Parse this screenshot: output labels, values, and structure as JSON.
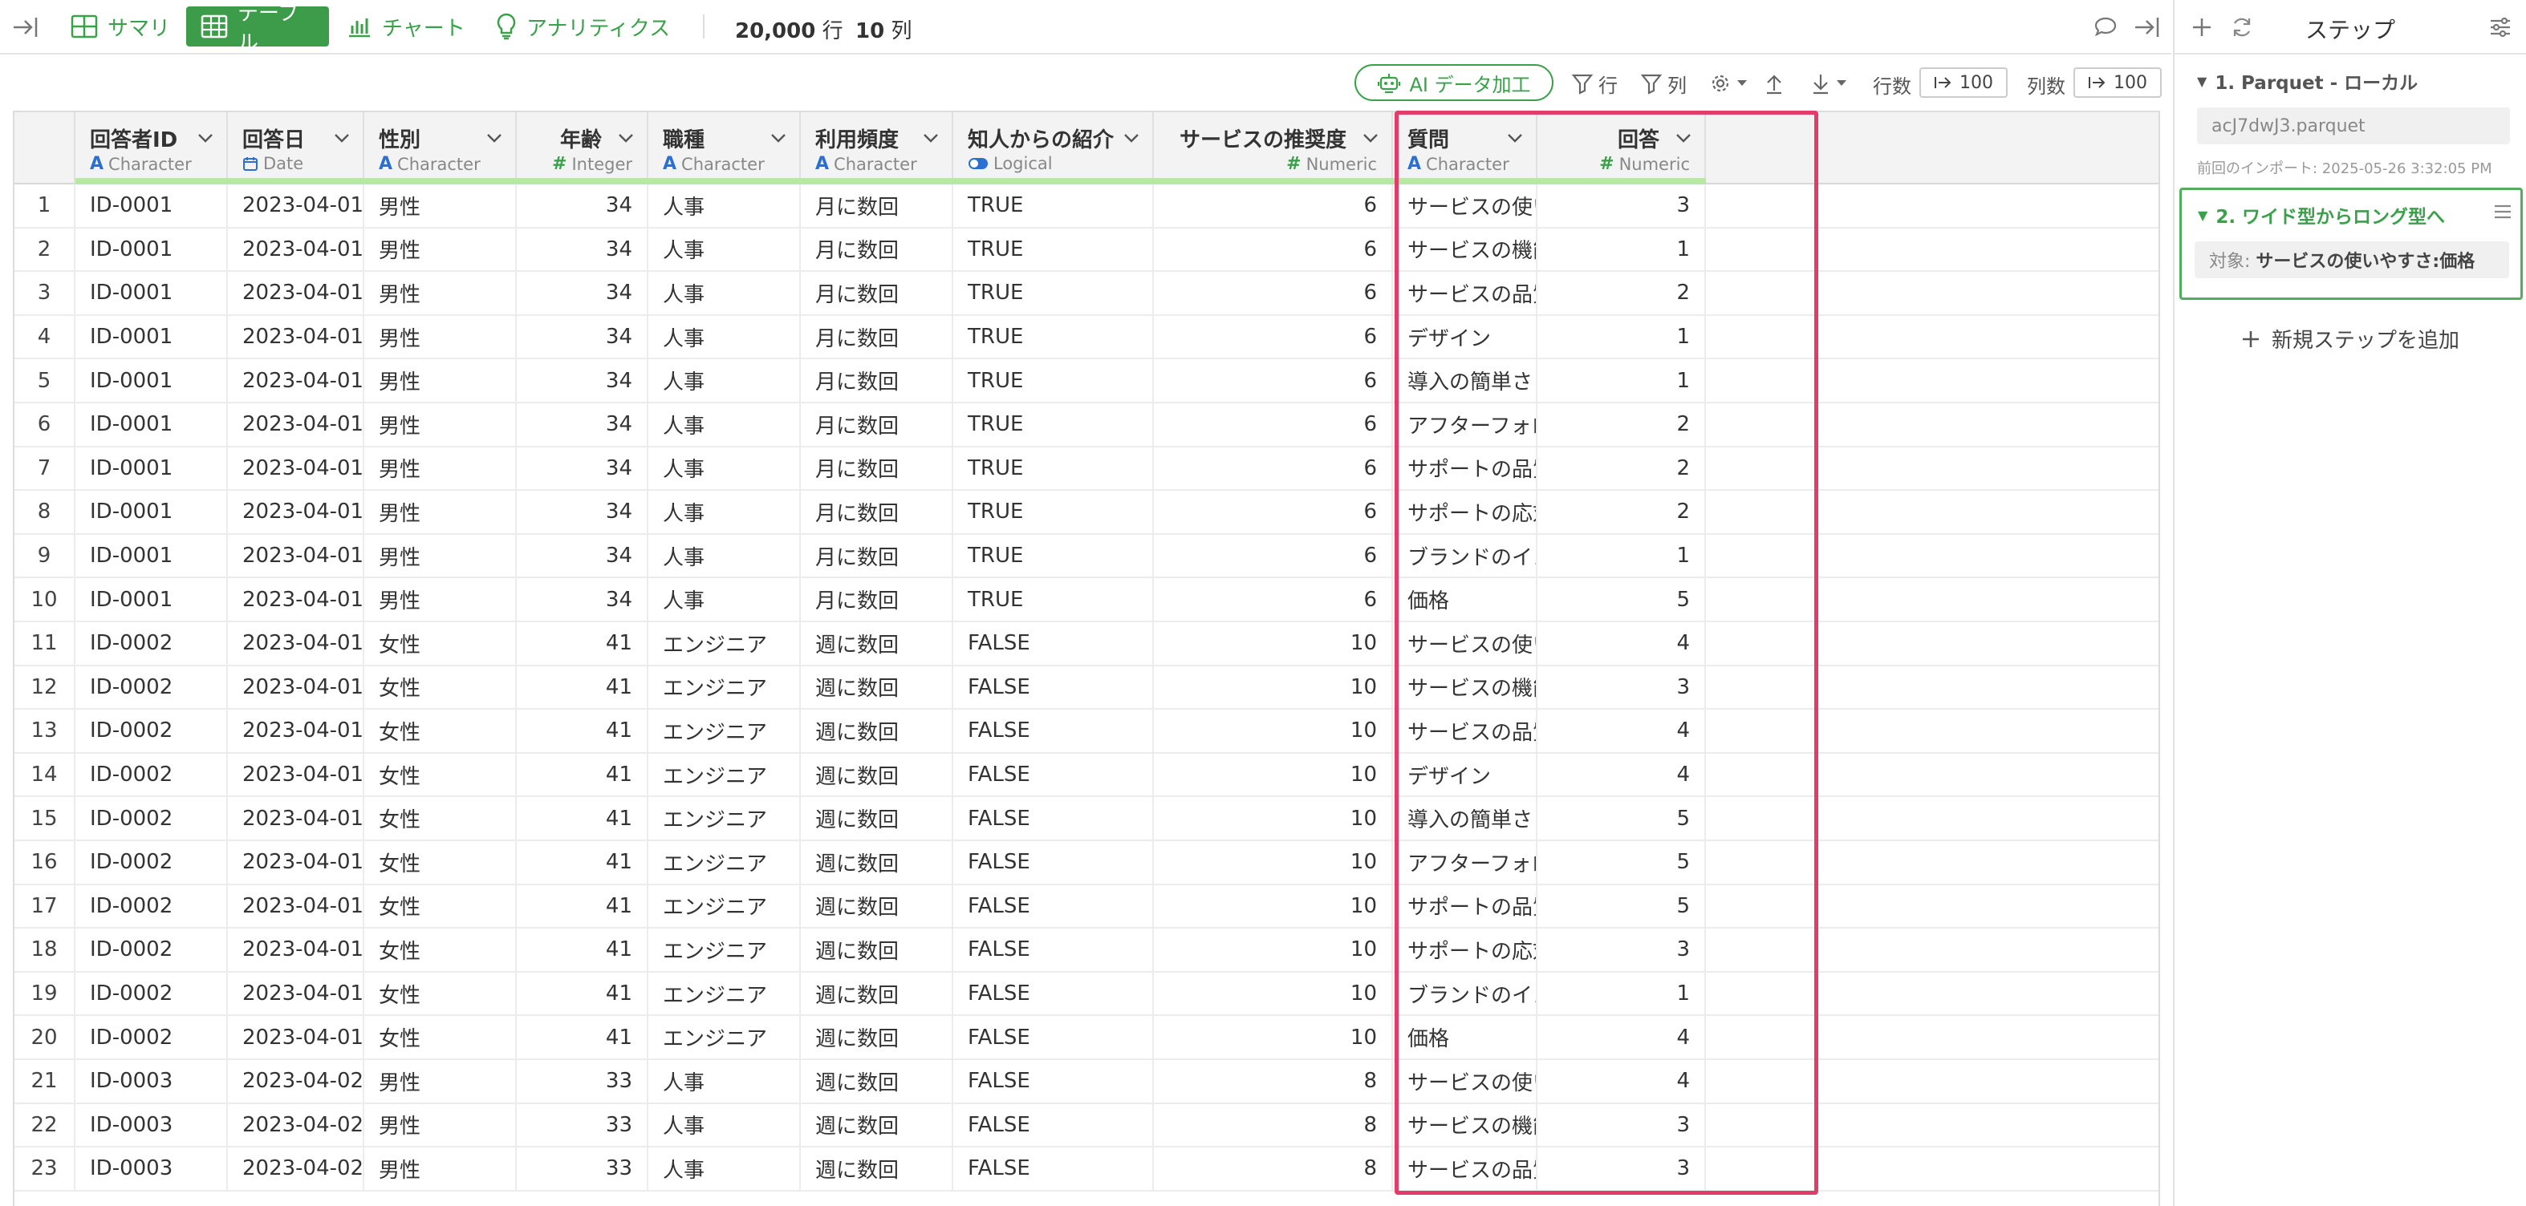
{
  "nav": {
    "tabs": [
      {
        "label": "サマリ",
        "icon": "summary-icon"
      },
      {
        "label": "テーブル",
        "icon": "table-icon",
        "active": true
      },
      {
        "label": "チャート",
        "icon": "chart-icon"
      },
      {
        "label": "アナリティクス",
        "icon": "lightbulb-icon"
      }
    ],
    "row_count": "20,000",
    "row_unit": "行",
    "col_count": "10",
    "col_unit": "列"
  },
  "toolbar": {
    "ai_label": "AI データ加工",
    "row_filter": "行",
    "col_filter": "列",
    "rows_label": "行数",
    "rows_value": "100",
    "cols_label": "列数",
    "cols_value": "100"
  },
  "table": {
    "columns": [
      {
        "name": "回答者ID",
        "type": "Character",
        "glyph": "A"
      },
      {
        "name": "回答日",
        "type": "Date",
        "glyph": "calendar"
      },
      {
        "name": "性別",
        "type": "Character",
        "glyph": "A"
      },
      {
        "name": "年齢",
        "type": "Integer",
        "glyph": "#"
      },
      {
        "name": "職種",
        "type": "Character",
        "glyph": "A"
      },
      {
        "name": "利用頻度",
        "type": "Character",
        "glyph": "A"
      },
      {
        "name": "知人からの紹介",
        "type": "Logical",
        "glyph": "toggle"
      },
      {
        "name": "サービスの推奨度",
        "type": "Numeric",
        "glyph": "#"
      },
      {
        "name": "質問",
        "type": "Character",
        "glyph": "A"
      },
      {
        "name": "回答",
        "type": "Numeric",
        "glyph": "#"
      }
    ],
    "rows": [
      [
        "1",
        "ID-0001",
        "2023-04-01",
        "男性",
        "34",
        "人事",
        "月に数回",
        "TRUE",
        "6",
        "サービスの使いやすさ",
        "3"
      ],
      [
        "2",
        "ID-0001",
        "2023-04-01",
        "男性",
        "34",
        "人事",
        "月に数回",
        "TRUE",
        "6",
        "サービスの機能の豊富さ",
        "1"
      ],
      [
        "3",
        "ID-0001",
        "2023-04-01",
        "男性",
        "34",
        "人事",
        "月に数回",
        "TRUE",
        "6",
        "サービスの品質",
        "2"
      ],
      [
        "4",
        "ID-0001",
        "2023-04-01",
        "男性",
        "34",
        "人事",
        "月に数回",
        "TRUE",
        "6",
        "デザイン",
        "1"
      ],
      [
        "5",
        "ID-0001",
        "2023-04-01",
        "男性",
        "34",
        "人事",
        "月に数回",
        "TRUE",
        "6",
        "導入の簡単さ",
        "1"
      ],
      [
        "6",
        "ID-0001",
        "2023-04-01",
        "男性",
        "34",
        "人事",
        "月に数回",
        "TRUE",
        "6",
        "アフターフォローの充実度",
        "2"
      ],
      [
        "7",
        "ID-0001",
        "2023-04-01",
        "男性",
        "34",
        "人事",
        "月に数回",
        "TRUE",
        "6",
        "サポートの品質",
        "2"
      ],
      [
        "8",
        "ID-0001",
        "2023-04-01",
        "男性",
        "34",
        "人事",
        "月に数回",
        "TRUE",
        "6",
        "サポートの応対速度",
        "2"
      ],
      [
        "9",
        "ID-0001",
        "2023-04-01",
        "男性",
        "34",
        "人事",
        "月に数回",
        "TRUE",
        "6",
        "ブランドのイメージ",
        "1"
      ],
      [
        "10",
        "ID-0001",
        "2023-04-01",
        "男性",
        "34",
        "人事",
        "月に数回",
        "TRUE",
        "6",
        "価格",
        "5"
      ],
      [
        "11",
        "ID-0002",
        "2023-04-01",
        "女性",
        "41",
        "エンジニア",
        "週に数回",
        "FALSE",
        "10",
        "サービスの使いやすさ",
        "4"
      ],
      [
        "12",
        "ID-0002",
        "2023-04-01",
        "女性",
        "41",
        "エンジニア",
        "週に数回",
        "FALSE",
        "10",
        "サービスの機能の豊富さ",
        "3"
      ],
      [
        "13",
        "ID-0002",
        "2023-04-01",
        "女性",
        "41",
        "エンジニア",
        "週に数回",
        "FALSE",
        "10",
        "サービスの品質",
        "4"
      ],
      [
        "14",
        "ID-0002",
        "2023-04-01",
        "女性",
        "41",
        "エンジニア",
        "週に数回",
        "FALSE",
        "10",
        "デザイン",
        "4"
      ],
      [
        "15",
        "ID-0002",
        "2023-04-01",
        "女性",
        "41",
        "エンジニア",
        "週に数回",
        "FALSE",
        "10",
        "導入の簡単さ",
        "5"
      ],
      [
        "16",
        "ID-0002",
        "2023-04-01",
        "女性",
        "41",
        "エンジニア",
        "週に数回",
        "FALSE",
        "10",
        "アフターフォローの充実度",
        "5"
      ],
      [
        "17",
        "ID-0002",
        "2023-04-01",
        "女性",
        "41",
        "エンジニア",
        "週に数回",
        "FALSE",
        "10",
        "サポートの品質",
        "5"
      ],
      [
        "18",
        "ID-0002",
        "2023-04-01",
        "女性",
        "41",
        "エンジニア",
        "週に数回",
        "FALSE",
        "10",
        "サポートの応対速度",
        "3"
      ],
      [
        "19",
        "ID-0002",
        "2023-04-01",
        "女性",
        "41",
        "エンジニア",
        "週に数回",
        "FALSE",
        "10",
        "ブランドのイメージ",
        "1"
      ],
      [
        "20",
        "ID-0002",
        "2023-04-01",
        "女性",
        "41",
        "エンジニア",
        "週に数回",
        "FALSE",
        "10",
        "価格",
        "4"
      ],
      [
        "21",
        "ID-0003",
        "2023-04-02",
        "男性",
        "33",
        "人事",
        "週に数回",
        "FALSE",
        "8",
        "サービスの使いやすさ",
        "4"
      ],
      [
        "22",
        "ID-0003",
        "2023-04-02",
        "男性",
        "33",
        "人事",
        "週に数回",
        "FALSE",
        "8",
        "サービスの機能の豊富さ",
        "3"
      ],
      [
        "23",
        "ID-0003",
        "2023-04-02",
        "男性",
        "33",
        "人事",
        "週に数回",
        "FALSE",
        "8",
        "サービスの品質",
        "3"
      ]
    ]
  },
  "panel": {
    "title": "ステップ",
    "step1_title": "1. Parquet - ローカル",
    "step1_file": "acJ7dwJ3.parquet",
    "step1_note": "前回のインポート: 2025-05-26 3:32:05 PM",
    "step2_title": "2. ワイド型からロング型へ",
    "step2_target_label": "対象:",
    "step2_target_value": "サービスの使いやすさ:価格",
    "add_step": "新規ステップを追加"
  },
  "colors": {
    "accent": "#3d9c49",
    "highlight": "#e23d6a"
  }
}
